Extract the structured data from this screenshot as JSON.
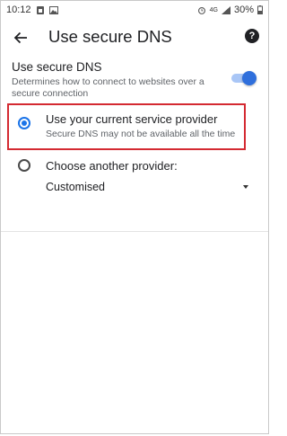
{
  "status_bar": {
    "time": "10:12",
    "network": "4G",
    "battery": "30%",
    "icons": [
      "sim-icon",
      "gallery-icon",
      "alarm-icon",
      "signal-icon",
      "battery-icon"
    ]
  },
  "app_bar": {
    "title": "Use secure DNS",
    "back_icon": "arrow-back-icon",
    "help_icon": "help-icon",
    "help_glyph": "?"
  },
  "secure_dns_toggle": {
    "title": "Use secure DNS",
    "description": "Determines how to connect to websites over a secure connection",
    "enabled": true
  },
  "options": {
    "current_provider": {
      "title": "Use your current service provider",
      "subtitle": "Secure DNS may not be available all the time",
      "selected": true
    },
    "another_provider": {
      "title": "Choose another provider:",
      "selected": false
    }
  },
  "provider_dropdown": {
    "selected": "Customised"
  },
  "colors": {
    "accent": "#1a73e8",
    "highlight_border": "#d42a32"
  }
}
